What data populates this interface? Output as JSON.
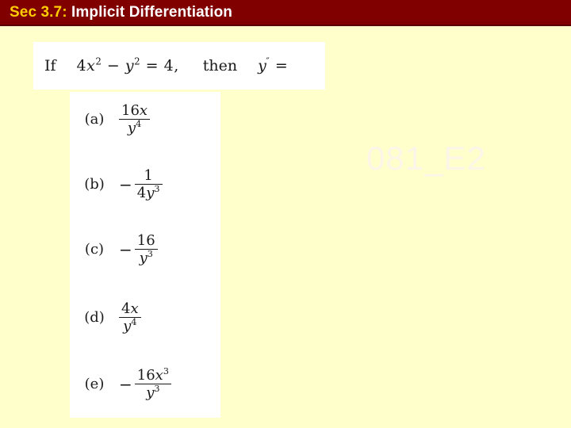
{
  "slide": {
    "background_color": "#ffffcc",
    "title_bar": {
      "background_color": "#800000",
      "sec_label": "Sec 3.7:",
      "sec_label_color": "#ffcc00",
      "title": "Implicit Differentiation",
      "title_color": "#ffffff"
    },
    "watermark": {
      "text": "081_E2",
      "color": "#fdf6e8"
    },
    "question": {
      "if_word": "If",
      "equation": {
        "coefficient": "4",
        "x_var": "x",
        "x_exponent": "2",
        "minus": "−",
        "y_var": "y",
        "y_exponent": "2",
        "equals": "=",
        "rhs": "4,"
      },
      "then_word": "then",
      "derivative": {
        "var": "y",
        "primes": "″",
        "equals": "="
      },
      "plain_text": "If 4x² − y² = 4, then y″ ="
    },
    "choices": [
      {
        "label": "(a)",
        "sign": "",
        "numerator": "16x",
        "numerator_base": "16",
        "numerator_var": "x",
        "numerator_exponent": "",
        "denominator_var": "y",
        "denominator_exponent": "4",
        "plain_text": "16x / y⁴"
      },
      {
        "label": "(b)",
        "sign": "−",
        "numerator": "1",
        "numerator_base": "1",
        "numerator_var": "",
        "numerator_exponent": "",
        "denominator_coefficient": "4",
        "denominator_var": "y",
        "denominator_exponent": "3",
        "plain_text": "− 1 / 4y³"
      },
      {
        "label": "(c)",
        "sign": "−",
        "numerator": "16",
        "numerator_base": "16",
        "numerator_var": "",
        "numerator_exponent": "",
        "denominator_var": "y",
        "denominator_exponent": "3",
        "plain_text": "− 16 / y³"
      },
      {
        "label": "(d)",
        "sign": "",
        "numerator": "4x",
        "numerator_base": "4",
        "numerator_var": "x",
        "numerator_exponent": "",
        "denominator_var": "y",
        "denominator_exponent": "4",
        "plain_text": "4x / y⁴"
      },
      {
        "label": "(e)",
        "sign": "−",
        "numerator": "16x³",
        "numerator_base": "16",
        "numerator_var": "x",
        "numerator_exponent": "3",
        "denominator_var": "y",
        "denominator_exponent": "3",
        "plain_text": "− 16x³ / y³"
      }
    ]
  }
}
